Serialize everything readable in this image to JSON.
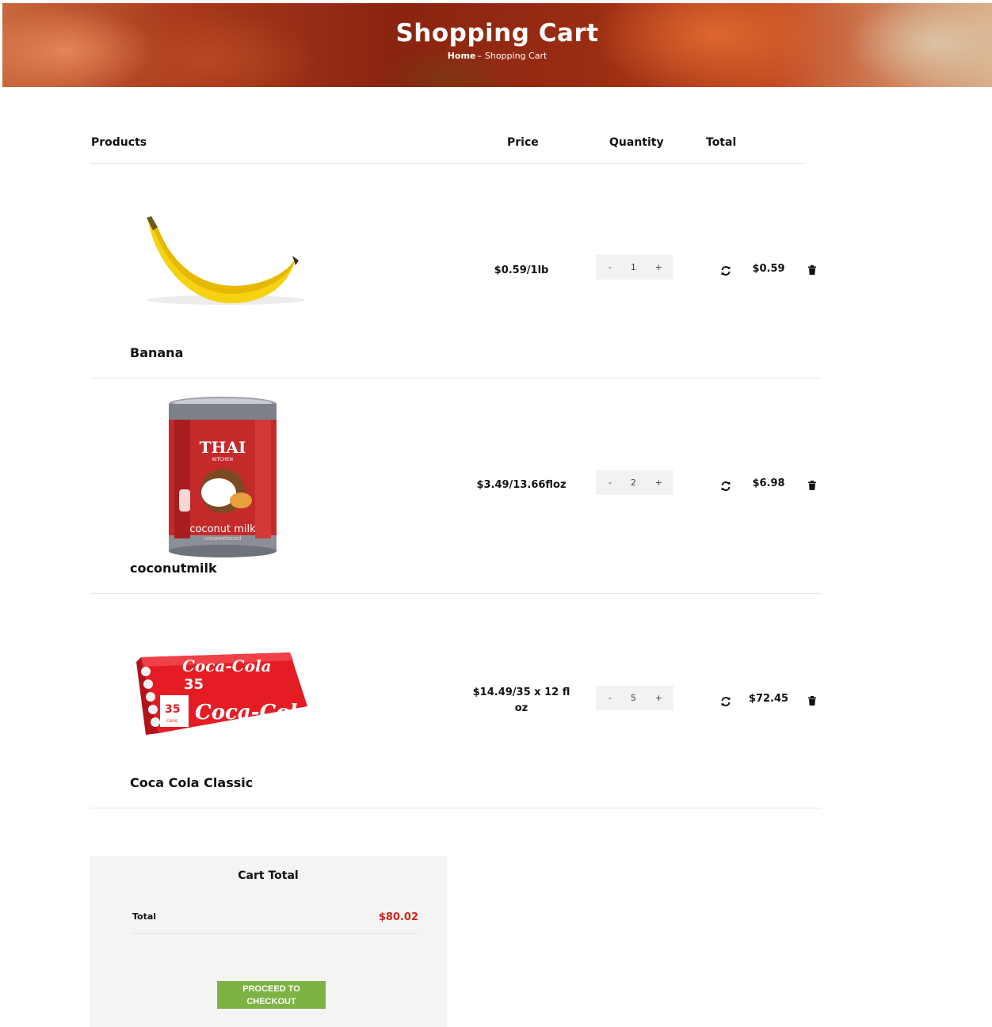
{
  "banner": {
    "title": "Shopping Cart",
    "breadcrumb_home": "Home",
    "breadcrumb_sep": "–",
    "breadcrumb_current": "Shopping Cart"
  },
  "table": {
    "headers": [
      "Products",
      "Price",
      "Quantity",
      "Total"
    ]
  },
  "items": [
    {
      "name": "Banana",
      "price": "$0.59/1lb",
      "quantity": "1",
      "total": "$0.59",
      "image": "banana"
    },
    {
      "name": "coconutmilk",
      "price": "$3.49/13.66floz",
      "quantity": "2",
      "total": "$6.98",
      "image": "coconut-milk-can"
    },
    {
      "name": "Coca Cola Classic",
      "price": "$14.49/35 x 12 fl oz",
      "quantity": "5",
      "total": "$72.45",
      "image": "coca-cola-35-pack"
    }
  ],
  "qty_controls": {
    "minus": "-",
    "plus": "+"
  },
  "cart_total": {
    "title": "Cart Total",
    "label": "Total",
    "value": "$80.02",
    "button": "PROCEED TO CHECKOUT"
  },
  "colors": {
    "accent_green": "#7cb342",
    "total_red": "#d0281c",
    "panel_bg": "#f4f4f4"
  },
  "icons": [
    "refresh-icon",
    "trash-icon"
  ]
}
